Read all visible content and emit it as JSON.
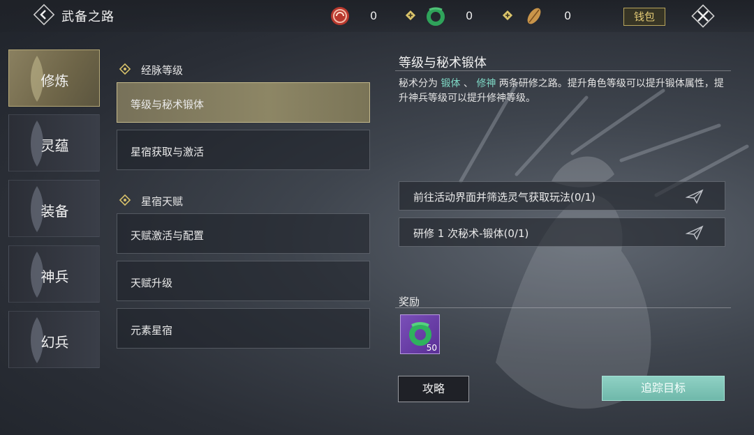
{
  "header": {
    "title": "武备之路",
    "currencies": [
      {
        "icon": "red-coin-icon",
        "value": "0"
      },
      {
        "icon": "jade-ring-icon",
        "value": "0"
      },
      {
        "icon": "golden-leaf-icon",
        "value": "0"
      }
    ],
    "wallet_label": "钱包"
  },
  "sidebar": {
    "items": [
      {
        "label": "修炼",
        "active": true
      },
      {
        "label": "灵蕴",
        "active": false
      },
      {
        "label": "装备",
        "active": false
      },
      {
        "label": "神兵",
        "active": false
      },
      {
        "label": "幻兵",
        "active": false
      }
    ]
  },
  "list": {
    "sections": [
      {
        "title": "经脉等级",
        "items": [
          "等级与秘术锻体",
          "星宿获取与激活"
        ]
      },
      {
        "title": "星宿天赋",
        "items": [
          "天赋激活与配置",
          "天赋升级",
          "元素星宿"
        ]
      }
    ],
    "active_item": "等级与秘术锻体"
  },
  "detail": {
    "title": "等级与秘术锻体",
    "desc_1": "秘术分为 ",
    "desc_hl1": "锻体",
    "desc_2": " 、 ",
    "desc_hl2": "修神",
    "desc_3": " 两条研修之路。提升角色等级可以提升锻体属性，提升神兵等级可以提升修神等级。",
    "tasks": [
      "前往活动界面并筛选灵气获取玩法(0/1)",
      "研修 1 次秘术-锻体(0/1)"
    ],
    "reward_title": "奖励",
    "reward_qty": "50",
    "guide_button": "攻略",
    "track_button": "追踪目标"
  },
  "colors": {
    "highlight": "#7fd9c6",
    "track_button": "#7cc4b6",
    "active_tab": "#7a7256"
  }
}
